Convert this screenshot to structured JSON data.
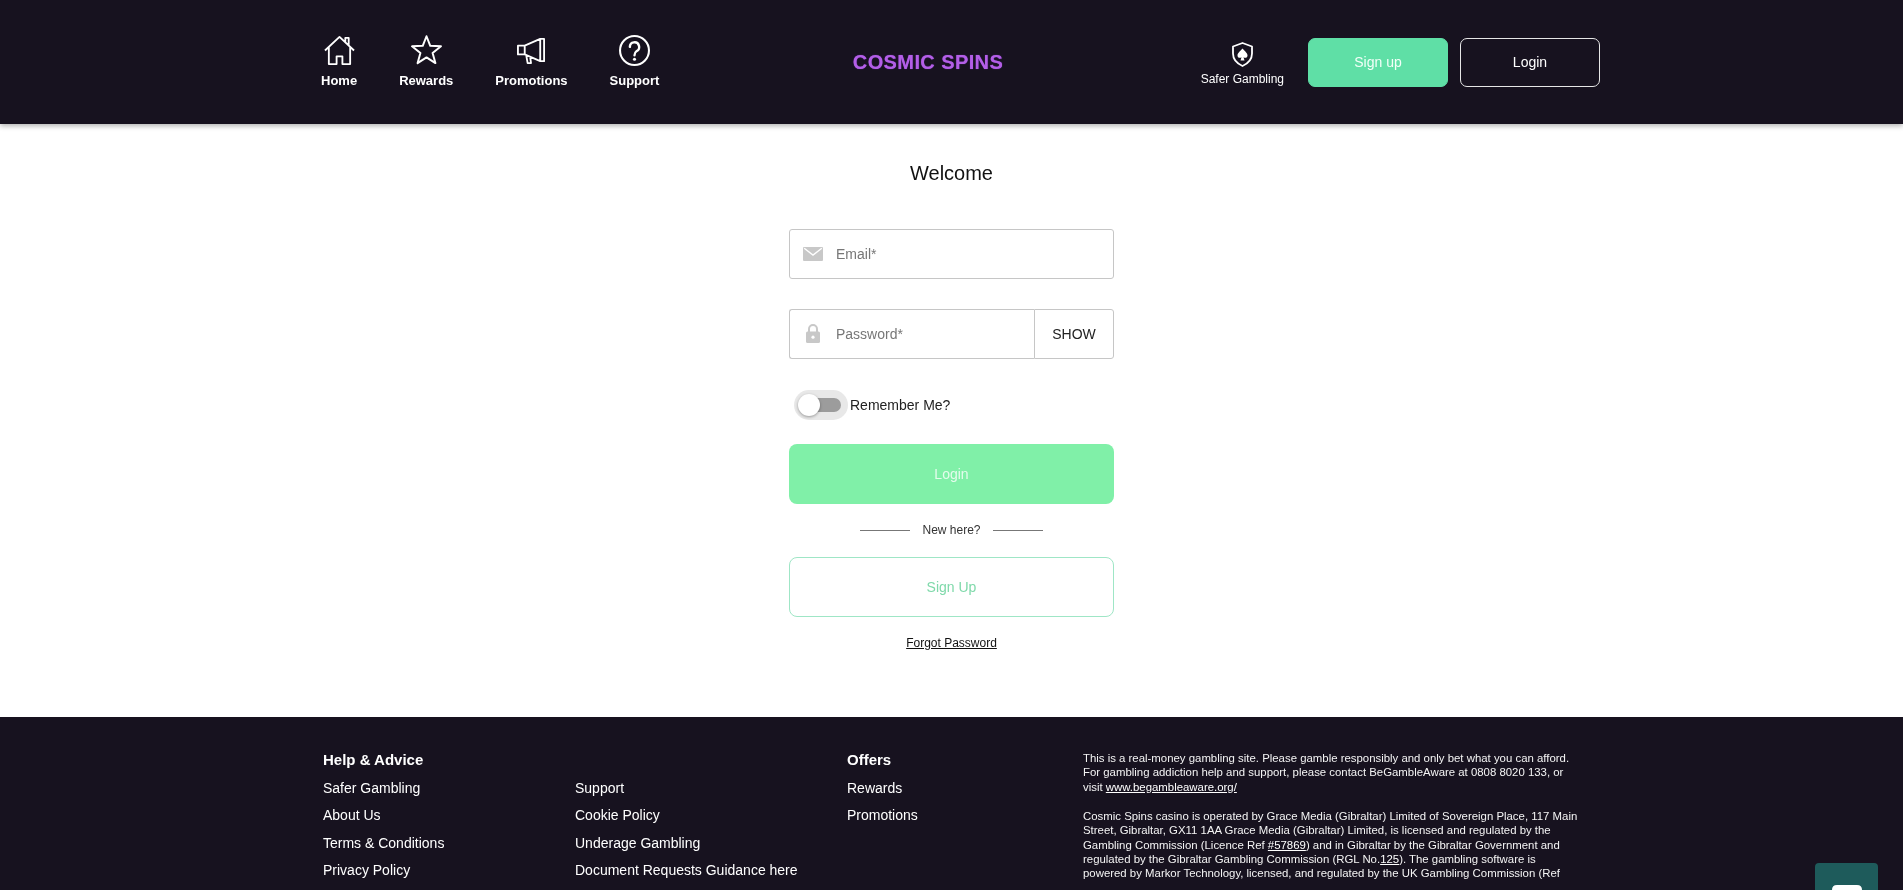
{
  "header": {
    "nav": [
      {
        "label": "Home"
      },
      {
        "label": "Rewards"
      },
      {
        "label": "Promotions"
      },
      {
        "label": "Support"
      }
    ],
    "logo": "COSMIC SPINS",
    "safer_gambling": {
      "label": "Safer Gambling"
    },
    "buttons": [
      {
        "label": "Sign up",
        "kind": "primary"
      },
      {
        "label": "Login",
        "kind": "outline"
      }
    ]
  },
  "login_form": {
    "title": "Welcome",
    "email": {
      "placeholder": "Email*"
    },
    "password": {
      "placeholder": "Password*",
      "toggle": "SHOW"
    },
    "remember_me": {
      "label": "Remember Me?",
      "on": false
    },
    "submit": {
      "label": "Login",
      "disabled": true
    },
    "divider": "New here?",
    "signup": {
      "label": "Sign Up"
    },
    "forgot_password": "Forgot Password"
  },
  "footer": {
    "columns": [
      {
        "heading": "Help & Advice",
        "links": [
          "Safer Gambling",
          "About Us",
          "Terms & Conditions",
          "Privacy Policy"
        ]
      },
      {
        "links": [
          "Support",
          "Cookie Policy",
          "Underage Gambling",
          "Document Requests Guidance here"
        ]
      },
      {
        "heading": "Offers",
        "links": [
          "Rewards",
          "Promotions"
        ]
      }
    ],
    "legal": [
      {
        "parts": [
          {
            "kind": "text",
            "text": "This is a real-money gambling site. Please gamble responsibly and only bet what you can afford. For gambling addiction help and support, please contact BeGambleAware at 0808 8020 133, or visit "
          },
          {
            "kind": "link",
            "text": "www.begambleaware.org/"
          }
        ]
      },
      {
        "parts": [
          {
            "kind": "text",
            "text": "Cosmic Spins casino is operated by Grace Media (Gibraltar) Limited of Sovereign Place, 117 Main Street, Gibraltar, GX11 1AA Grace Media (Gibraltar) Limited, is licensed and regulated by the Gambling Commission (Licence Ref "
          },
          {
            "kind": "link",
            "text": "#57869"
          },
          {
            "kind": "text",
            "text": ") and in Gibraltar by the Gibraltar Government and regulated by the Gibraltar Gambling Commission (RGL No."
          },
          {
            "kind": "link",
            "text": "125"
          },
          {
            "kind": "text",
            "text": "). The gambling software is powered by Markor Technology, licensed, and regulated by the UK Gambling Commission (Ref"
          }
        ]
      }
    ]
  }
}
